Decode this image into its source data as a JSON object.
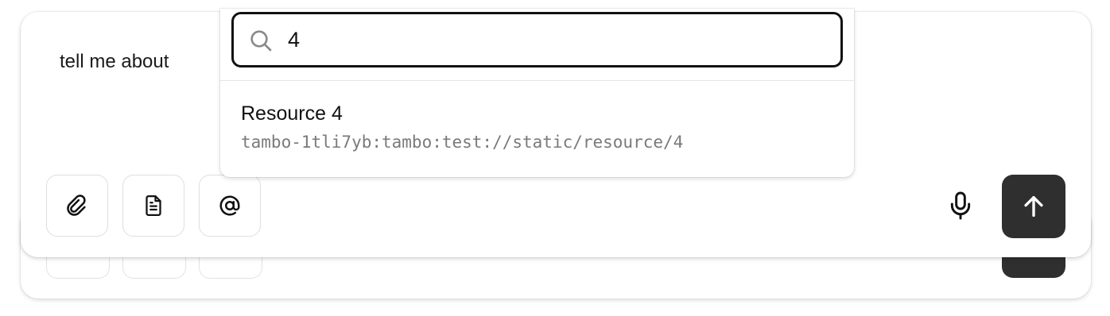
{
  "composer": {
    "message_text": "tell me about",
    "buttons": {
      "attach_icon": "paperclip-icon",
      "resource_icon": "document-icon",
      "mention_icon": "at-sign-icon",
      "mic_icon": "microphone-icon",
      "send_icon": "arrow-up-icon"
    }
  },
  "resource_picker": {
    "search_value": "4",
    "search_icon": "search-icon",
    "results": [
      {
        "title": "Resource 4",
        "uri": "tambo-1tli7yb:tambo:test://static/resource/4"
      }
    ]
  },
  "colors": {
    "send_button_bg": "#2f2f2f",
    "border": "#dedede",
    "uri_text": "#7a7a7a"
  }
}
